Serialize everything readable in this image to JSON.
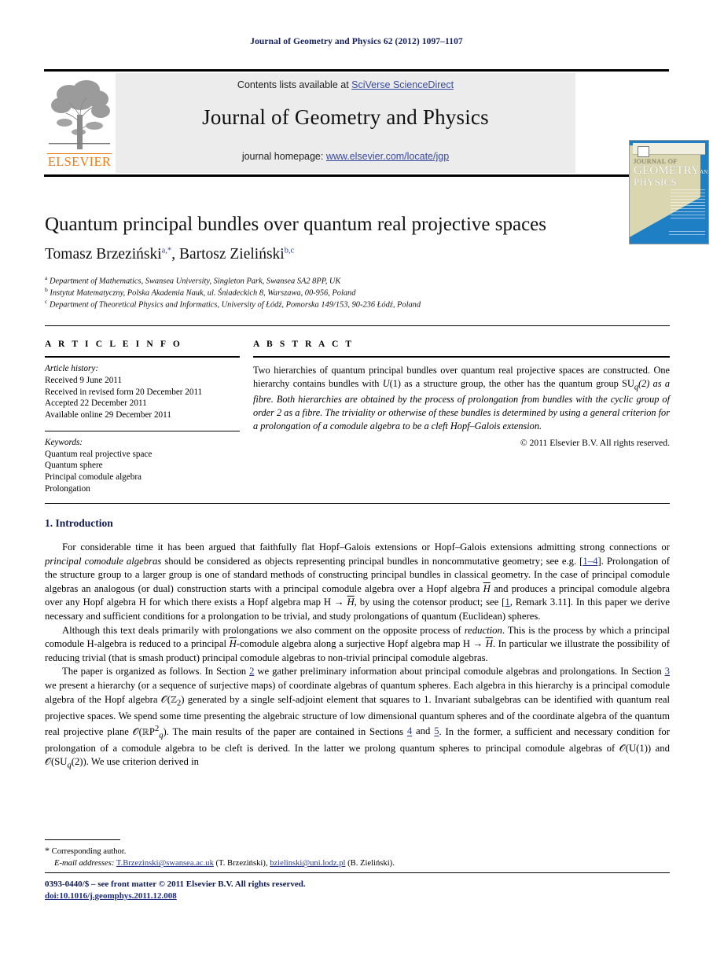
{
  "running_head": "Journal of Geometry and Physics 62 (2012) 1097–1107",
  "masthead": {
    "contents_prefix": "Contents lists available at ",
    "contents_link": "SciVerse ScienceDirect",
    "journal_title": "Journal of Geometry and Physics",
    "homepage_prefix": "journal homepage: ",
    "homepage_link": "www.elsevier.com/locate/jgp",
    "publisher_wordmark": "ELSEVIER"
  },
  "cover": {
    "line1": "JOURNAL OF",
    "line2": "GEOMETRY",
    "line3": "PHYSICS",
    "and": "AND"
  },
  "article": {
    "title": "Quantum principal bundles over quantum real projective spaces",
    "authors": [
      {
        "name": "Tomasz Brzeziński",
        "sup": "a,*"
      },
      {
        "name": "Bartosz Zieliński",
        "sup": "b,c"
      }
    ],
    "authors_separator": ", ",
    "affiliations": [
      {
        "marker": "a",
        "text": "Department of Mathematics, Swansea University, Singleton Park, Swansea SA2 8PP, UK"
      },
      {
        "marker": "b",
        "text": "Instytut Matematyczny, Polska Akademia Nauk, ul. Śniadeckich 8, Warszawa, 00-956, Poland"
      },
      {
        "marker": "c",
        "text": "Department of Theoretical Physics and Informatics, University of Łódź, Pomorska 149/153, 90-236 Łódź, Poland"
      }
    ]
  },
  "info": {
    "heading": "A R T I C L E   I N F O",
    "history_heading": "Article history:",
    "history": [
      "Received 9 June 2011",
      "Received in revised form 20 December 2011",
      "Accepted 22 December 2011",
      "Available online 29 December 2011"
    ],
    "keywords_heading": "Keywords:",
    "keywords": [
      "Quantum real projective space",
      "Quantum sphere",
      "Principal comodule algebra",
      "Prolongation"
    ]
  },
  "abstract": {
    "heading": "A B S T R A C T",
    "text": "Two hierarchies of quantum principal bundles over quantum real projective spaces are constructed. One hierarchy contains bundles with U(1) as a structure group, the other has the quantum group SUq(2) as a fibre. Both hierarchies are obtained by the process of prolongation from bundles with the cyclic group of order 2 as a fibre. The triviality or otherwise of these bundles is determined by using a general criterion for a prolongation of a comodule algebra to be a cleft Hopf–Galois extension.",
    "copyright": "© 2011 Elsevier B.V. All rights reserved."
  },
  "body": {
    "section_number": "1.",
    "section_title": "Introduction",
    "paragraph1_part1": "For considerable time it has been argued that faithfully flat Hopf–Galois extensions or Hopf–Galois extensions admitting strong connections or ",
    "paragraph1_italic1": "principal comodule algebras",
    "paragraph1_part2": " should be considered as objects representing principal bundles in noncommutative geometry; see e.g. [",
    "paragraph1_ref1": "1–4",
    "paragraph1_part3": "]. Prolongation of the structure group to a larger group is one of standard methods of constructing principal bundles in classical geometry. In the case of principal comodule algebras an analogous (or dual) construction starts with a principal comodule algebra over a Hopf algebra ",
    "paragraph1_part4": " and produces a principal comodule algebra over any Hopf algebra H for which there exists a Hopf algebra map H → ",
    "paragraph1_part5": ", by using the cotensor product; see [",
    "paragraph1_ref2": "1",
    "paragraph1_part6": ", Remark 3.11]. In this paper we derive necessary and sufficient conditions for a prolongation to be trivial, and study prolongations of quantum (Euclidean) spheres.",
    "paragraph2_part1": "Although this text deals primarily with prolongations we also comment on the opposite process of ",
    "paragraph2_italic1": "reduction",
    "paragraph2_part2": ". This is the process by which a principal comodule H-algebra is reduced to a principal ",
    "paragraph2_part3": "-comodule algebra along a surjective Hopf algebra map H → ",
    "paragraph2_part4": ". In particular we illustrate the possibility of reducing trivial (that is smash product) principal comodule algebras to non-trivial principal comodule algebras.",
    "paragraph3_part1": "The paper is organized as follows. In Section ",
    "paragraph3_ref1": "2",
    "paragraph3_part2": " we gather preliminary information about principal comodule algebras and prolongations. In Section ",
    "paragraph3_ref2": "3",
    "paragraph3_part3": " we present a hierarchy (or a sequence of surjective maps) of coordinate algebras of quantum spheres. Each algebra in this hierarchy is a principal comodule algebra of the Hopf algebra 𝒪(ℤ2) generated by a single self-adjoint element that squares to 1. Invariant subalgebras can be identified with quantum real projective spaces. We spend some time presenting the algebraic structure of low dimensional quantum spheres and of the coordinate algebra of the quantum real projective plane 𝒪(ℝP2q). The main results of the paper are contained in Sections ",
    "paragraph3_ref3": "4",
    "paragraph3_part4": " and ",
    "paragraph3_ref4": "5",
    "paragraph3_part5": ". In the former, a sufficient and necessary condition for prolongation of a comodule algebra to be cleft is derived. In the latter we prolong quantum spheres to principal comodule algebras of 𝒪(U(1)) and 𝒪(SUq(2)). We use criterion derived in"
  },
  "footnote": {
    "corresponding": "Corresponding author.",
    "email_label": "E-mail addresses:",
    "email1": "T.Brzezinski@swansea.ac.uk",
    "email1_owner": "(T. Brzeziński),",
    "email2": "bzielinski@uni.lodz.pl",
    "email2_owner": "(B. Zieliński)."
  },
  "page_footer": {
    "copyright": "0393-0440/$ – see front matter © 2011 Elsevier B.V. All rights reserved.",
    "doi": "doi:10.1016/j.geomphys.2011.12.008"
  }
}
